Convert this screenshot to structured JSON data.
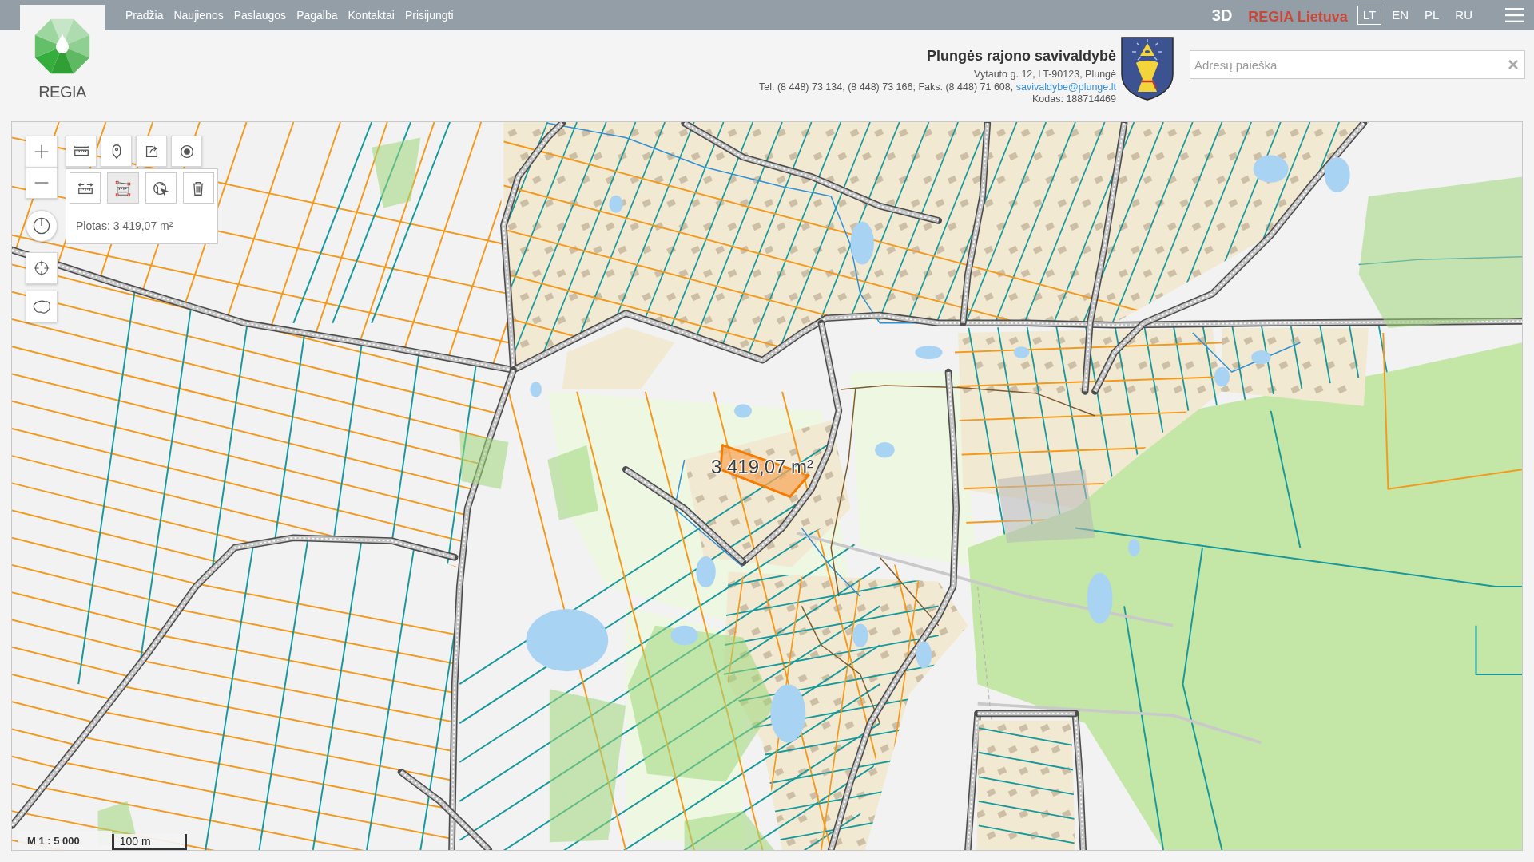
{
  "top_bar": {
    "nav": [
      {
        "label": "Pradžia"
      },
      {
        "label": "Naujienos"
      },
      {
        "label": "Paslaugos"
      },
      {
        "label": "Pagalba"
      },
      {
        "label": "Kontaktai"
      },
      {
        "label": "Prisijungti"
      }
    ],
    "view_3d": "3D",
    "brand": "REGIA Lietuva",
    "languages": [
      {
        "label": "LT",
        "selected": true
      },
      {
        "label": "EN",
        "selected": false
      },
      {
        "label": "PL",
        "selected": false
      },
      {
        "label": "RU",
        "selected": false
      }
    ]
  },
  "logo": {
    "text": "REGIA"
  },
  "municipality": {
    "name": "Plungės rajono savivaldybė",
    "address": "Vytauto g. 12, LT-90123, Plungė",
    "contacts": "Tel. (8 448) 73 134, (8 448) 73 166; Faks. (8 448) 71 608,",
    "email": "savivaldybe@plunge.lt",
    "code": "Kodas: 188714469"
  },
  "search": {
    "placeholder": "Adresų paieška"
  },
  "map": {
    "measure_panel": {
      "tools": [
        {
          "kind": "distance",
          "selected": false
        },
        {
          "kind": "area",
          "selected": true
        },
        {
          "kind": "globe",
          "selected": false
        },
        {
          "kind": "delete",
          "selected": false
        }
      ],
      "result": "Plotas: 3 419,07 m²"
    },
    "area_label": "3 419,07 m²",
    "scale": {
      "ratio": "M 1 : 5 000",
      "bar": "100 m"
    }
  }
}
